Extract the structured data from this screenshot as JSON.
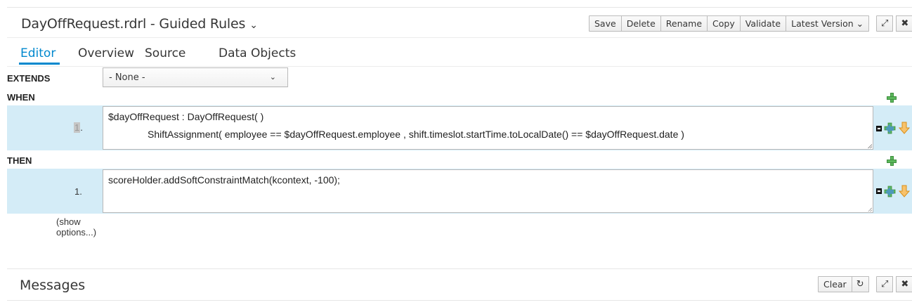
{
  "header": {
    "title": "DayOffRequest.rdrl - Guided Rules",
    "title_chevron": "⌄",
    "buttons": [
      "Save",
      "Delete",
      "Rename",
      "Copy",
      "Validate",
      "Latest Version ⌄"
    ],
    "maximize_glyph": "⤢",
    "close_glyph": "✖"
  },
  "tabs": [
    "Editor",
    "Overview",
    "Source",
    "Data Objects"
  ],
  "active_tab": "Editor",
  "extends": {
    "label": "EXTENDS",
    "selected": "- None -",
    "caret": "⌄"
  },
  "when": {
    "label": "WHEN",
    "row_number": "1",
    "row_suffix": ".",
    "lines": [
      "$dayOffRequest : DayOffRequest( )",
      "ShiftAssignment( employee == $dayOffRequest.employee , shift.timeslot.startTime.toLocalDate() == $dayOffRequest.date )"
    ]
  },
  "then": {
    "label": "THEN",
    "row_number": "1.",
    "lines": [
      "scoreHolder.addSoftConstraintMatch(kcontext, -100);"
    ]
  },
  "show_options": {
    "line1": "(show",
    "line2": "options...)"
  },
  "messages": {
    "title": "Messages",
    "clear": "Clear",
    "refresh_glyph": "↻",
    "maximize_glyph": "⤢",
    "close_glyph": "✖"
  },
  "colors": {
    "accent": "#0088ce",
    "row_band": "#d4ecf7",
    "plus_green": "#5cb85c",
    "arrow_orange": "#f0ad4e"
  }
}
